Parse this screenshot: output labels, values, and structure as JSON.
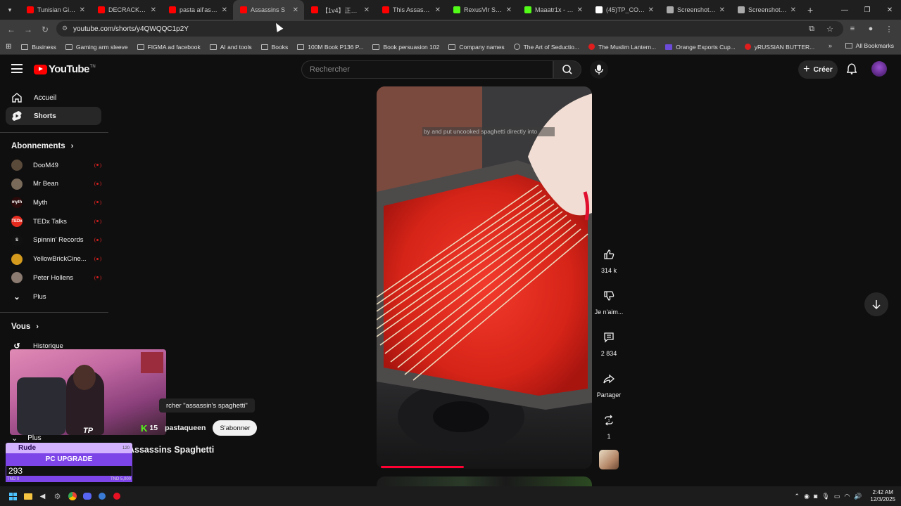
{
  "browser": {
    "tabs": [
      {
        "title": "Tunisian Girl C",
        "color": "#ff0000"
      },
      {
        "title": "DECRACKER#s",
        "color": "#ff0000"
      },
      {
        "title": "pasta all'assas",
        "color": "#ff0000"
      },
      {
        "title": "Assassins S",
        "color": "#ff0000",
        "active": true
      },
      {
        "title": "【1v4】正真正",
        "color": "#ff0000"
      },
      {
        "title": "This Assassin's",
        "color": "#ff0000"
      },
      {
        "title": "RexusVlr Strea",
        "color": "#53fc18"
      },
      {
        "title": "Maaatr1x - Wa",
        "color": "#53fc18"
      },
      {
        "title": "(45)TP_CORE",
        "color": "#ffffff"
      },
      {
        "title": "Screenshot_20",
        "color": "#aaaaaa"
      },
      {
        "title": "Screenshot_20",
        "color": "#aaaaaa"
      }
    ],
    "url": "youtube.com/shorts/y4QWQQC1p2Y",
    "bookmarks": [
      {
        "label": "Business",
        "type": "folder"
      },
      {
        "label": "Gaming arm sleeve",
        "type": "folder"
      },
      {
        "label": "FIGMA ad facebook",
        "type": "folder"
      },
      {
        "label": "AI and tools",
        "type": "folder"
      },
      {
        "label": "Books",
        "type": "folder"
      },
      {
        "label": "100M Book P136 P...",
        "type": "folder"
      },
      {
        "label": "Book persuasion 102",
        "type": "folder"
      },
      {
        "label": "Company names",
        "type": "folder"
      },
      {
        "label": "The Art of Seductio...",
        "type": "globe"
      },
      {
        "label": "The Muslim Lantern...",
        "type": "yt"
      },
      {
        "label": "Orange Esports Cup...",
        "type": "purple"
      },
      {
        "label": "уRUSSIAN BUTTER...",
        "type": "yt"
      }
    ],
    "all_bookmarks": "All Bookmarks"
  },
  "youtube": {
    "logo_text": "YouTube",
    "logo_tm": "TN",
    "search_placeholder": "Rechercher",
    "create_label": "Créer",
    "sidebar": {
      "home": "Accueil",
      "shorts": "Shorts",
      "subscriptions_title": "Abonnements",
      "subscriptions": [
        {
          "name": "DooM49",
          "color": "#5a4a3a",
          "initial": ""
        },
        {
          "name": "Mr Bean",
          "color": "#7a6a5a",
          "initial": ""
        },
        {
          "name": "Myth",
          "color": "#2a0a0a",
          "initial": "myth"
        },
        {
          "name": "TEDx Talks",
          "color": "#e62b1e",
          "initial": "TEDx"
        },
        {
          "name": "Spinnin' Records",
          "color": "#111111",
          "initial": "S"
        },
        {
          "name": "YellowBrickCine...",
          "color": "#d49a1e",
          "initial": ""
        },
        {
          "name": "Peter Hollens",
          "color": "#8a7a70",
          "initial": ""
        }
      ],
      "more": "Plus",
      "you_title": "Vous",
      "history": "Historique",
      "more2": "Plus"
    },
    "short": {
      "caption": "by and put uncooked spaghetti directly into",
      "likes": "314 k",
      "dislike_label": "Je n'aim...",
      "comments": "2 834",
      "share_label": "Partager",
      "remix_count": "1",
      "progress": 0.4,
      "title": "Assassins Spaghetti",
      "channel": "pastaqueen",
      "subscribe_label": "S'abonner",
      "search_hint": "rcher \"assassin's spaghetti\""
    }
  },
  "overlay": {
    "kick_icon": "K",
    "kick_count": "15",
    "webcam_logo": "TP",
    "widget": {
      "top_label": "Rude",
      "top_num": "120",
      "goal_label": "PC UPGRADE",
      "current": "293",
      "min": "TND 0",
      "max": "TND 5,000"
    }
  },
  "taskbar": {
    "time": "2:42 AM",
    "date": "12/3/2025"
  }
}
